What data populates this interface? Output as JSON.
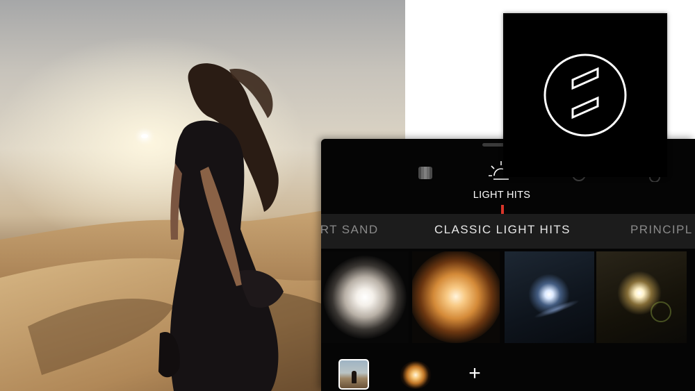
{
  "toolbar": {
    "active_tool_label": "LIGHT HITS",
    "tools": [
      "layers-icon",
      "sun-icon",
      "dim-circle-icon",
      "drop-icon"
    ]
  },
  "categories": {
    "left": "ERT SAND",
    "center": "CLASSIC LIGHT HITS",
    "right": "PRINCIPL"
  },
  "bottom_bar": {
    "add_label": "+"
  },
  "colors": {
    "indicator": "#d8352a",
    "panel_bg": "#050505",
    "category_bar": "#1c1c1c"
  }
}
